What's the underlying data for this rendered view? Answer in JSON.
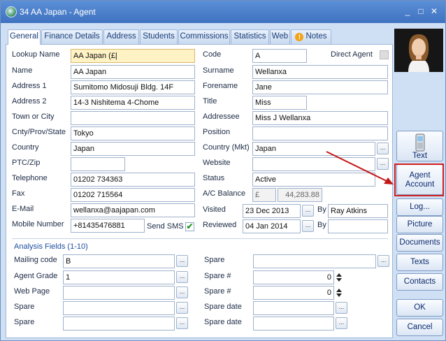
{
  "window": {
    "title": "34 AA Japan - Agent",
    "controls": [
      "_",
      "□",
      "✕"
    ]
  },
  "tabs": [
    {
      "label": "General"
    },
    {
      "label": "Finance Details"
    },
    {
      "label": "Address"
    },
    {
      "label": "Students"
    },
    {
      "label": "Commissions"
    },
    {
      "label": "Statistics"
    },
    {
      "label": "Web"
    },
    {
      "label": "Notes"
    }
  ],
  "left": {
    "lookup_name": {
      "label": "Lookup Name",
      "value": "AA Japan (£|"
    },
    "name": {
      "label": "Name",
      "value": "AA Japan"
    },
    "address1": {
      "label": "Address 1",
      "value": "Sumitomo Midosuji Bldg. 14F"
    },
    "address2": {
      "label": "Address 2",
      "value": "14-3 Nishitema 4-Chome"
    },
    "town": {
      "label": "Town or City",
      "value": ""
    },
    "county": {
      "label": "Cnty/Prov/State",
      "value": "Tokyo"
    },
    "country": {
      "label": "Country",
      "value": "Japan"
    },
    "ptc": {
      "label": "PTC/Zip",
      "value": ""
    },
    "telephone": {
      "label": "Telephone",
      "value": "01202 734363"
    },
    "fax": {
      "label": "Fax",
      "value": "01202 715564"
    },
    "email": {
      "label": "E-Mail",
      "value": "wellanxa@aajapan.com"
    },
    "mobile": {
      "label": "Mobile Number",
      "value": "+81435476881"
    },
    "send_sms": {
      "label": "Send SMS",
      "checked": true
    }
  },
  "right": {
    "code": {
      "label": "Code",
      "value": "A"
    },
    "direct_agent": {
      "label": "Direct Agent",
      "checked": false
    },
    "surname": {
      "label": "Surname",
      "value": "Wellanxa"
    },
    "forename": {
      "label": "Forename",
      "value": "Jane"
    },
    "title": {
      "label": "Title",
      "value": "Miss"
    },
    "addressee": {
      "label": "Addressee",
      "value": "Miss J Wellanxa"
    },
    "position": {
      "label": "Position",
      "value": ""
    },
    "country_mkt": {
      "label": "Country (Mkt)",
      "value": "Japan"
    },
    "website": {
      "label": "Website",
      "value": ""
    },
    "status": {
      "label": "Status",
      "value": "Active"
    },
    "balance": {
      "label": "A/C Balance",
      "currency": "£",
      "value": "44,283.88"
    },
    "visited": {
      "label": "Visited",
      "date": "23 Dec 2013",
      "by_label": "By",
      "by": "Ray Atkins"
    },
    "reviewed": {
      "label": "Reviewed",
      "date": "04 Jan 2014",
      "by_label": "By",
      "by": ""
    }
  },
  "analysis": {
    "title": "Analysis Fields (1-10)",
    "left": [
      {
        "label": "Mailing code",
        "value": "B"
      },
      {
        "label": "Agent Grade",
        "value": "1"
      },
      {
        "label": "Web Page",
        "value": ""
      },
      {
        "label": "Spare",
        "value": ""
      },
      {
        "label": "Spare",
        "value": ""
      }
    ],
    "right": [
      {
        "label": "Spare",
        "value": ""
      },
      {
        "label": "Spare #",
        "value": "0"
      },
      {
        "label": "Spare #",
        "value": "0"
      },
      {
        "label": "Spare date",
        "value": ""
      },
      {
        "label": "Spare date",
        "value": ""
      }
    ]
  },
  "sidebar": {
    "text": "Text",
    "agent_account": "Agent Account",
    "log": "Log...",
    "picture": "Picture",
    "documents": "Documents",
    "texts": "Texts",
    "contacts": "Contacts",
    "ok": "OK",
    "cancel": "Cancel"
  },
  "dots": "..."
}
